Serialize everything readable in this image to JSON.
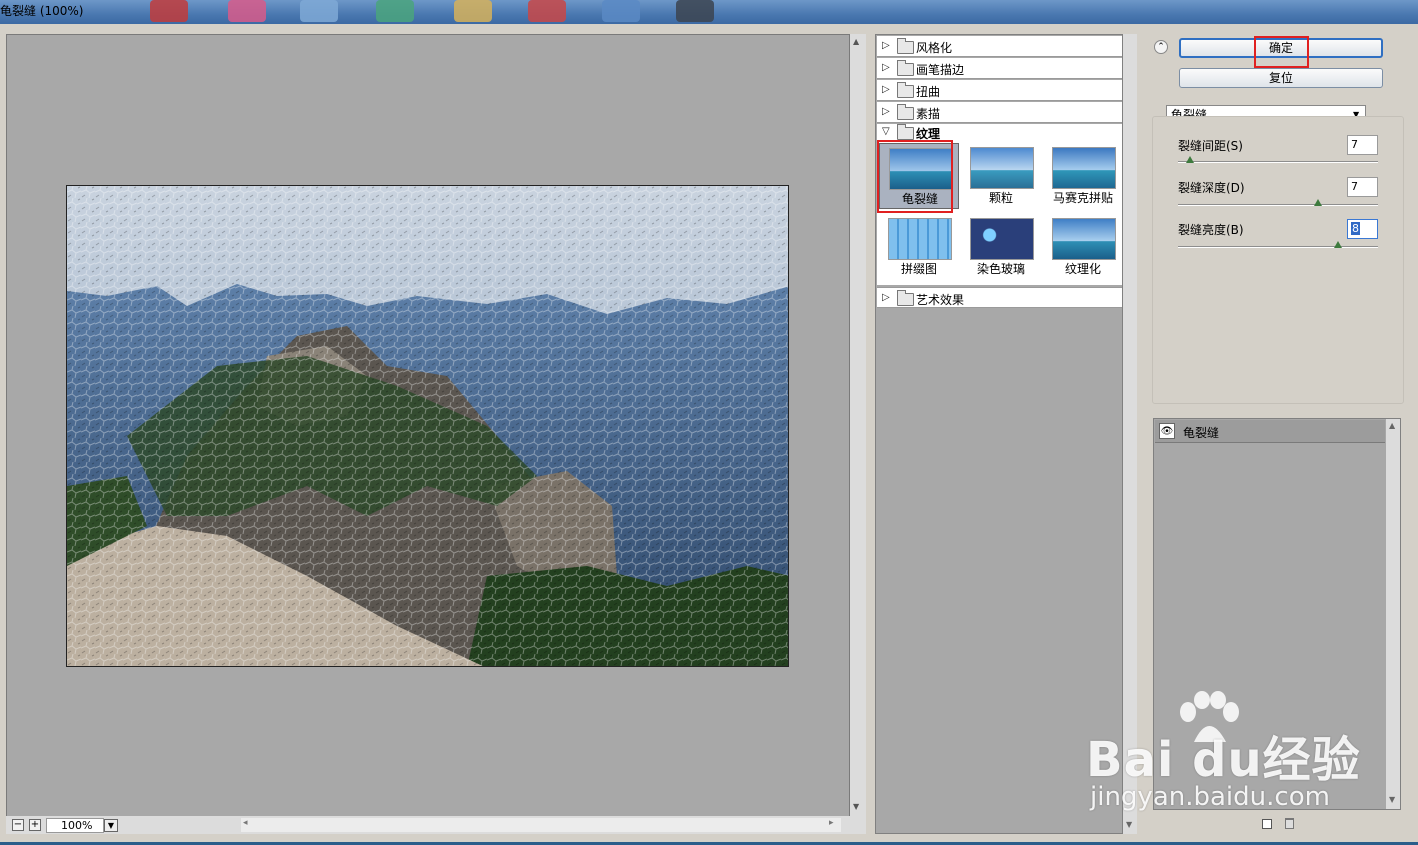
{
  "window": {
    "title": "龟裂缝 (100%)"
  },
  "preview": {
    "zoom_level": "100%",
    "zoom_out_symbol": "−",
    "zoom_in_symbol": "+"
  },
  "filter_gallery": {
    "categories": [
      {
        "label": "风格化",
        "expanded": false
      },
      {
        "label": "画笔描边",
        "expanded": false
      },
      {
        "label": "扭曲",
        "expanded": false
      },
      {
        "label": "素描",
        "expanded": false
      },
      {
        "label": "纹理",
        "expanded": true
      },
      {
        "label": "艺术效果",
        "expanded": false
      }
    ],
    "texture_filters": [
      {
        "label": "龟裂缝",
        "selected": true
      },
      {
        "label": "颗粒",
        "selected": false
      },
      {
        "label": "马赛克拼贴",
        "selected": false
      },
      {
        "label": "拼缀图",
        "selected": false
      },
      {
        "label": "染色玻璃",
        "selected": false
      },
      {
        "label": "纹理化",
        "selected": false
      }
    ]
  },
  "settings": {
    "ok_label": "确定",
    "reset_label": "复位",
    "filter_select_value": "龟裂缝",
    "params": [
      {
        "label": "裂缝间距(S)",
        "value": "7",
        "fraction": 0.06
      },
      {
        "label": "裂缝深度(D)",
        "value": "7",
        "fraction": 0.7
      },
      {
        "label": "裂缝亮度(B)",
        "value": "8",
        "fraction": 0.8
      }
    ]
  },
  "layers": {
    "items": [
      {
        "label": "龟裂缝"
      }
    ]
  },
  "watermark": {
    "brand": "Bai du经验",
    "url": "jingyan.baidu.com"
  },
  "colors": {
    "highlight_red": "#e02020",
    "button_border": "#2f6fc2"
  }
}
